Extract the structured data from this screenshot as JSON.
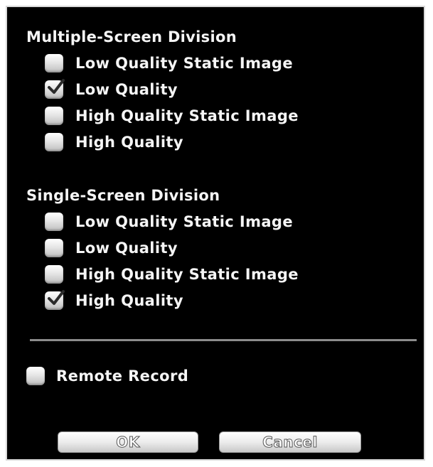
{
  "multiple_screen": {
    "title": "Multiple-Screen Division",
    "options": [
      {
        "label": "Low Quality Static Image",
        "checked": false
      },
      {
        "label": "Low Quality",
        "checked": true
      },
      {
        "label": "High Quality Static Image",
        "checked": false
      },
      {
        "label": "High Quality",
        "checked": false
      }
    ]
  },
  "single_screen": {
    "title": "Single-Screen Division",
    "options": [
      {
        "label": "Low Quality Static Image",
        "checked": false
      },
      {
        "label": "Low Quality",
        "checked": false
      },
      {
        "label": "High Quality Static Image",
        "checked": false
      },
      {
        "label": "High Quality",
        "checked": true
      }
    ]
  },
  "remote_record": {
    "label": "Remote Record",
    "checked": false
  },
  "buttons": {
    "ok": "OK",
    "cancel": "Cancel"
  },
  "colors": {
    "background": "#000000",
    "text": "#f5f5f5",
    "checkbox": "#e6e6e6",
    "divider": "#8c8c8c"
  },
  "icons": {
    "check": "check-icon"
  }
}
